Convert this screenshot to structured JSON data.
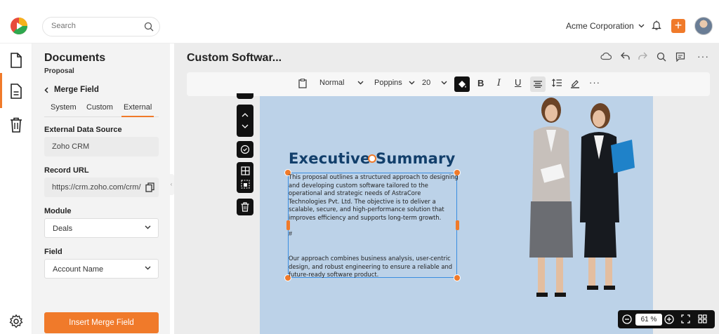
{
  "search": {
    "placeholder": "Search"
  },
  "header": {
    "org_name": "Acme Corporation",
    "plus_label": "+"
  },
  "panel": {
    "title": "Documents",
    "subtitle": "Proposal",
    "back_label": "Merge Field",
    "tabs": [
      {
        "label": "System",
        "active": false
      },
      {
        "label": "Custom",
        "active": false
      },
      {
        "label": "External",
        "active": true
      }
    ],
    "external_source": {
      "label": "External Data Source",
      "value": "Zoho CRM"
    },
    "record_url": {
      "label": "Record URL",
      "value": "https://crm.zoho.com/crm/"
    },
    "module": {
      "label": "Module",
      "value": "Deals"
    },
    "field": {
      "label": "Field",
      "value": "Account Name"
    },
    "insert_button": "Insert Merge Field"
  },
  "editor": {
    "title": "Custom Softwar...",
    "toolbar": {
      "style": "Normal",
      "font": "Poppins",
      "size": "20"
    },
    "heading": "Executive Summary",
    "paragraph1": "This proposal outlines a structured approach to designing and developing custom software tailored to the operational and strategic needs of AstraCore Technologies Pvt. Ltd. The objective is to deliver a scalable, secure, and high-performance solution that improves efficiency and supports long-term growth.",
    "hash": "#",
    "paragraph2": "Our approach combines business analysis, user-centric design, and robust engineering to ensure a reliable and future-ready software product.",
    "zoom": "61 %"
  },
  "colors": {
    "accent": "#f07a2a",
    "selection": "#3a8de0",
    "heading": "#123f6b",
    "canvas_bg": "#bcd2e8"
  }
}
